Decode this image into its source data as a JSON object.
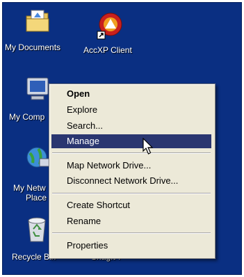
{
  "desktop": {
    "icons": {
      "my_documents": "My Documents",
      "accxp": "AccXP Client",
      "my_computer": "My Comp",
      "network_line1": "My Netw",
      "network_line2": "Place",
      "recycle_bin": "Recycle Bin",
      "snagit": "SnagIt 7"
    }
  },
  "context_menu": {
    "items": [
      {
        "label": "Open"
      },
      {
        "label": "Explore"
      },
      {
        "label": "Search..."
      },
      {
        "label": "Manage"
      },
      {
        "label": "Map Network Drive..."
      },
      {
        "label": "Disconnect Network Drive..."
      },
      {
        "label": "Create Shortcut"
      },
      {
        "label": "Rename"
      },
      {
        "label": "Properties"
      }
    ],
    "highlighted": "Manage",
    "highlight_color": "#2a3670"
  },
  "colors": {
    "desktop_background": "#0a2f82",
    "menu_background": "#ece9d8"
  }
}
